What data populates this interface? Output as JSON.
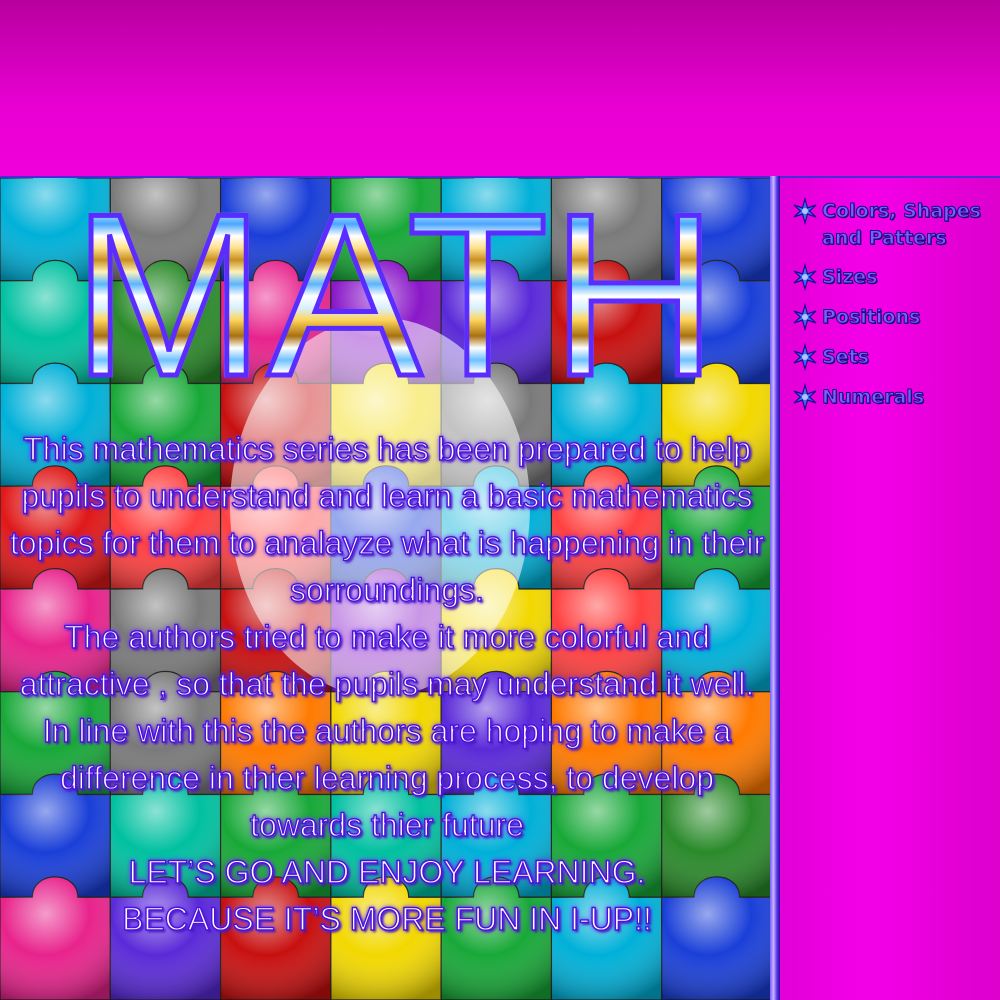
{
  "title": "MATH",
  "body": {
    "paragraphs": [
      "This mathematics series has been prepared to help pupils to understand and learn a basic mathematics topics for them  to analayze what is happening in their sorroundings.",
      "The authors tried to make it more colorful and attractive , so that the pupils may understand it well.",
      "In line with this the authors are hoping to make a difference in thier learning process, to develop towards thier future",
      "LET’S GO AND ENJOY LEARNING.",
      "BECAUSE IT’S MORE FUN IN I-UP!!"
    ]
  },
  "sidebar": {
    "items": [
      {
        "label": "Colors, Shapes and Patters",
        "icon": "asterisk-bullet-icon"
      },
      {
        "label": "Sizes",
        "icon": "asterisk-bullet-icon"
      },
      {
        "label": "Positions",
        "icon": "asterisk-bullet-icon"
      },
      {
        "label": "Sets",
        "icon": "asterisk-bullet-icon"
      },
      {
        "label": "Numerals",
        "icon": "asterisk-bullet-icon"
      }
    ]
  },
  "colors": {
    "background": "#f000dc",
    "nav_text": "#7a5cff",
    "text_outline": "#4a14d8",
    "divider": "#7a58ff"
  }
}
